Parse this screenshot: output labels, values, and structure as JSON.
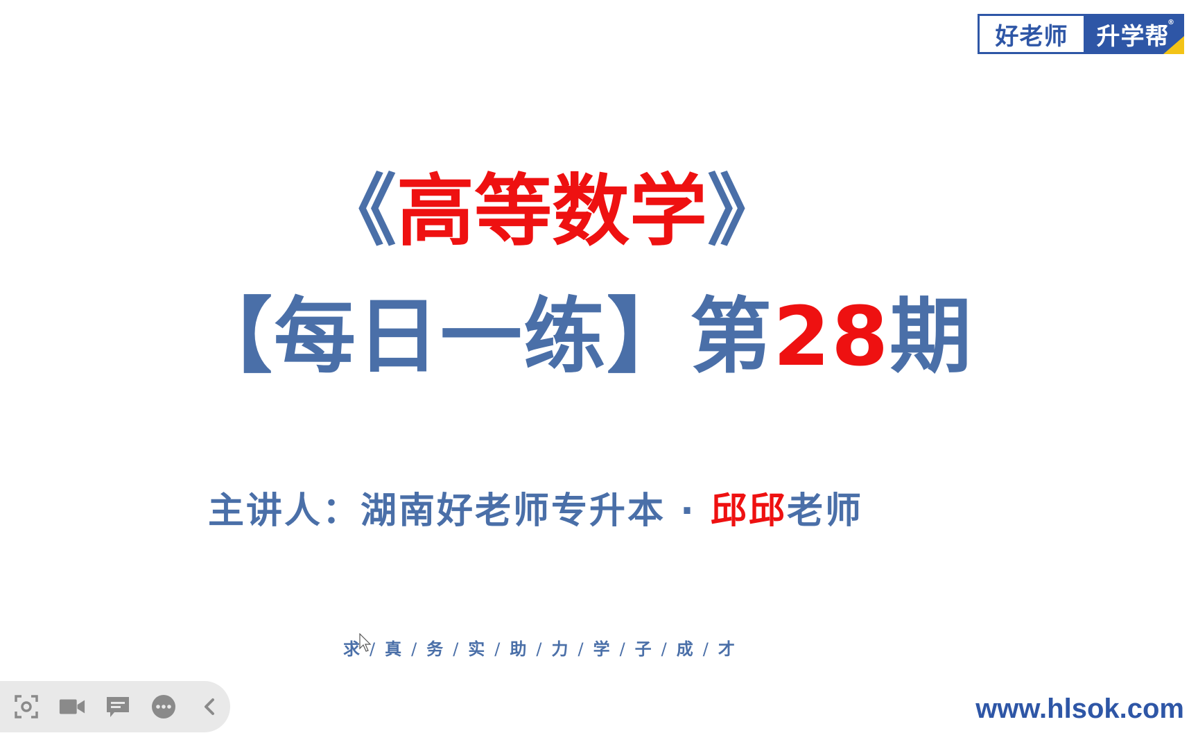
{
  "logo": {
    "left_text": "好老师",
    "right_text": "升学帮",
    "registered": "®",
    "colors": {
      "blue": "#2e56a6",
      "yellow": "#f3c316"
    }
  },
  "title_line1": {
    "open_bracket": "《",
    "subject": "高等数学",
    "close_bracket": "》"
  },
  "title_line2": {
    "open_bracket": "【",
    "series": "每日一练",
    "close_bracket": "】",
    "prefix": "第",
    "number": "28",
    "suffix": "期"
  },
  "presenter": {
    "label": "主讲人：湖南好老师专升本",
    "dot": "·",
    "name": "邱邱",
    "title": "老师"
  },
  "motto": [
    "求",
    "真",
    "务",
    "实",
    "助",
    "力",
    "学",
    "子",
    "成",
    "才"
  ],
  "motto_separator": "/",
  "website": "www.hlsok.com",
  "toolbar": {
    "icons": [
      "screenshot-icon",
      "video-camera-icon",
      "comment-icon",
      "more-icon",
      "collapse-chevron-icon"
    ]
  },
  "colors": {
    "title_blue": "#4a6fa8",
    "title_red": "#ee1111",
    "toolbar_bg": "#e9e9e9",
    "icon_gray": "#8a8a8a"
  }
}
